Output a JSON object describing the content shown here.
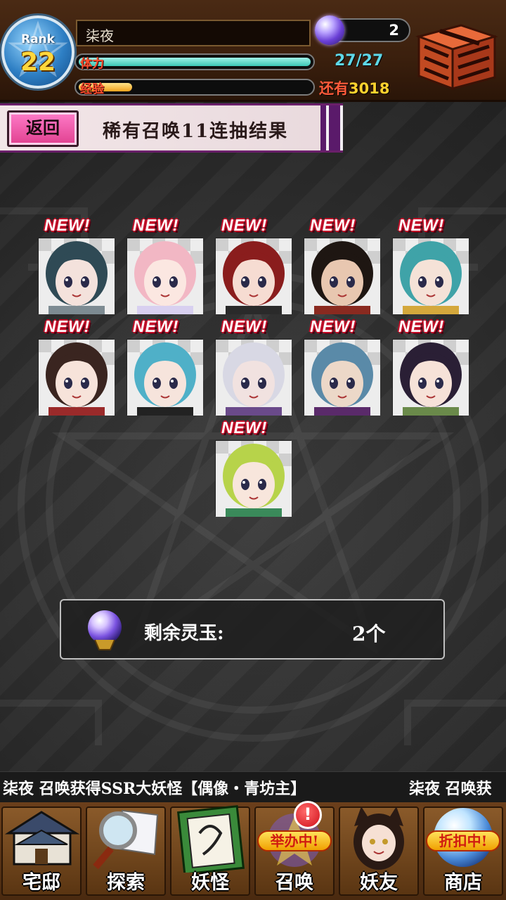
{
  "header": {
    "rank_label": "Rank",
    "rank_value": "22",
    "player_name": "柒夜",
    "stamina_label": "体力",
    "stamina_value": "27/27",
    "stamina_fraction": 1.0,
    "exp_label": "经验",
    "exp_fraction": 0.23,
    "exp_remaining_prefix": "还有",
    "exp_remaining_value": "3018",
    "orb_count": "2",
    "icons": {
      "rank": "pentagram-badge-icon",
      "orb": "spirit-orb-icon",
      "present": "present-box-icon"
    }
  },
  "banner": {
    "back_label": "返回",
    "title": "稀有召唤11连抽结果"
  },
  "results": {
    "badge_text": "NEW!",
    "cards": [
      {
        "name": "result-card-1",
        "hair": "#2f4a55",
        "skin": "#f4e2dc",
        "accent": "#7d8b92",
        "new": true
      },
      {
        "name": "result-card-2",
        "hair": "#f2b7c4",
        "skin": "#fbe7e1",
        "accent": "#d8d0f0",
        "new": true
      },
      {
        "name": "result-card-3",
        "hair": "#8a1d1d",
        "skin": "#f6dcd2",
        "accent": "#2a2a2a",
        "new": true
      },
      {
        "name": "result-card-4",
        "hair": "#1e1612",
        "skin": "#e8c7b0",
        "accent": "#8a2a20",
        "new": true
      },
      {
        "name": "result-card-5",
        "hair": "#3fa3a8",
        "skin": "#f5e2d7",
        "accent": "#d4a83c",
        "new": true
      },
      {
        "name": "result-card-6",
        "hair": "#3a2520",
        "skin": "#f7e3da",
        "accent": "#9a2a2a",
        "new": true
      },
      {
        "name": "result-card-7",
        "hair": "#4fb0c8",
        "skin": "#f6e4dc",
        "accent": "#222222",
        "new": true
      },
      {
        "name": "result-card-8",
        "hair": "#d8d8e4",
        "skin": "#f1e2e0",
        "accent": "#6a4a8a",
        "new": true
      },
      {
        "name": "result-card-9",
        "hair": "#5a8aa8",
        "skin": "#ecd8c8",
        "accent": "#5a2a6a",
        "new": true
      },
      {
        "name": "result-card-10",
        "hair": "#2a1f35",
        "skin": "#f6e2d8",
        "accent": "#6a8a4a",
        "new": true
      },
      {
        "name": "result-card-11",
        "hair": "#b7d34a",
        "skin": "#f8e6dc",
        "accent": "#3a8a5a",
        "new": true
      }
    ]
  },
  "remaining": {
    "label": "剩余灵玉:",
    "value": "2个",
    "icon": "spirit-orb-icon"
  },
  "ticker": {
    "message": "柒夜 召唤获得SSR大妖怪【偶像・青坊主】",
    "message_repeat": "柒夜 召唤获"
  },
  "nav": {
    "items": [
      {
        "label": "宅邸",
        "icon": "mansion-icon"
      },
      {
        "label": "探索",
        "icon": "magnifier-map-icon"
      },
      {
        "label": "妖怪",
        "icon": "scroll-icon"
      },
      {
        "label": "召唤",
        "icon": "summon-icon",
        "badge": "举办中!",
        "alert": "!"
      },
      {
        "label": "妖友",
        "icon": "friend-girl-icon"
      },
      {
        "label": "商店",
        "icon": "shop-orb-icon",
        "badge": "折扣中!"
      }
    ]
  },
  "colors": {
    "topbar": "#3a1f0d",
    "stamina": "#3cc6b5",
    "exp": "#f2a21c",
    "new_badge_outline": "#c4102a",
    "back_button": "#e0408f",
    "banner_stripe": "#5a1a6a"
  }
}
